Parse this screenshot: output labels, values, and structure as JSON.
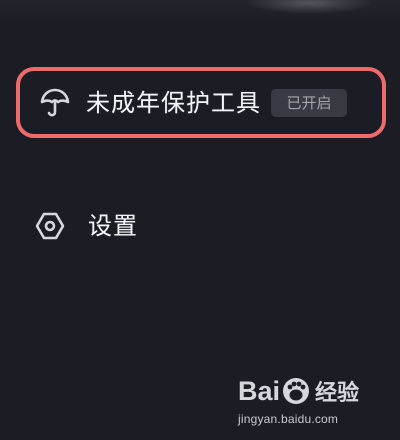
{
  "menu": {
    "items": [
      {
        "label": "未成年保护工具",
        "badge": "已开启",
        "icon": "umbrella-icon"
      },
      {
        "label": "设置",
        "icon": "gear-icon"
      }
    ]
  },
  "colors": {
    "background": "#1c1c25",
    "highlight_border": "#ef6b6b",
    "badge_background": "#3a3a44"
  },
  "watermark": {
    "brand_left": "Bai",
    "brand_right": "经验",
    "url": "jingyan.baidu.com"
  }
}
